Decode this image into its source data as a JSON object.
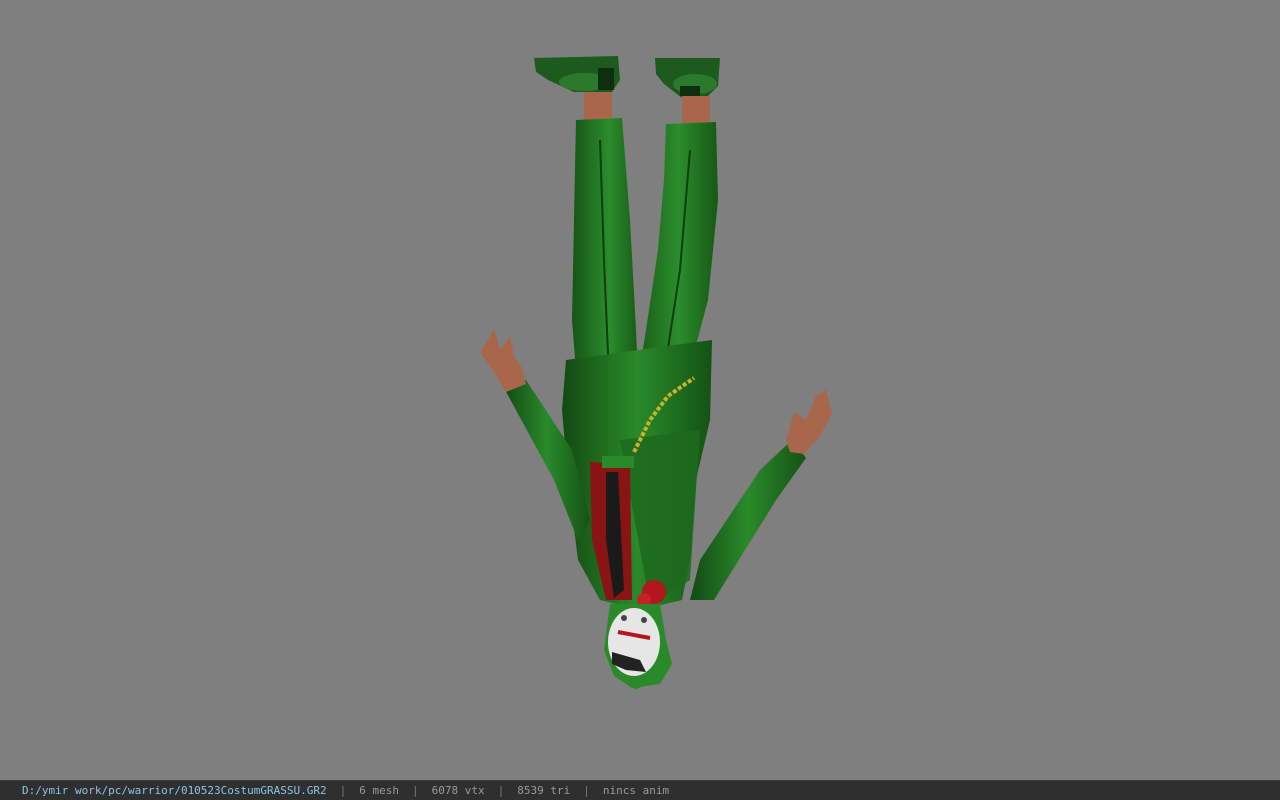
{
  "viewport": {
    "background": "#7f7f7f",
    "model": "character-model-icon"
  },
  "status": {
    "file_path": "D:/ymir work/pc/warrior/010523CostumGRASSU.GR2",
    "separator": "|",
    "mesh_count": "6 mesh",
    "vertex_count": "6078 vtx",
    "triangle_count": "8539 tri",
    "anim_status": "nincs anim"
  },
  "colors": {
    "suit_green": "#1f6e1f",
    "shirt_red": "#8a1414",
    "skin": "#a8674a",
    "chain_gold": "#c9b22a",
    "status_bar": "#2f2f2f",
    "path_text": "#8fc3e6"
  }
}
